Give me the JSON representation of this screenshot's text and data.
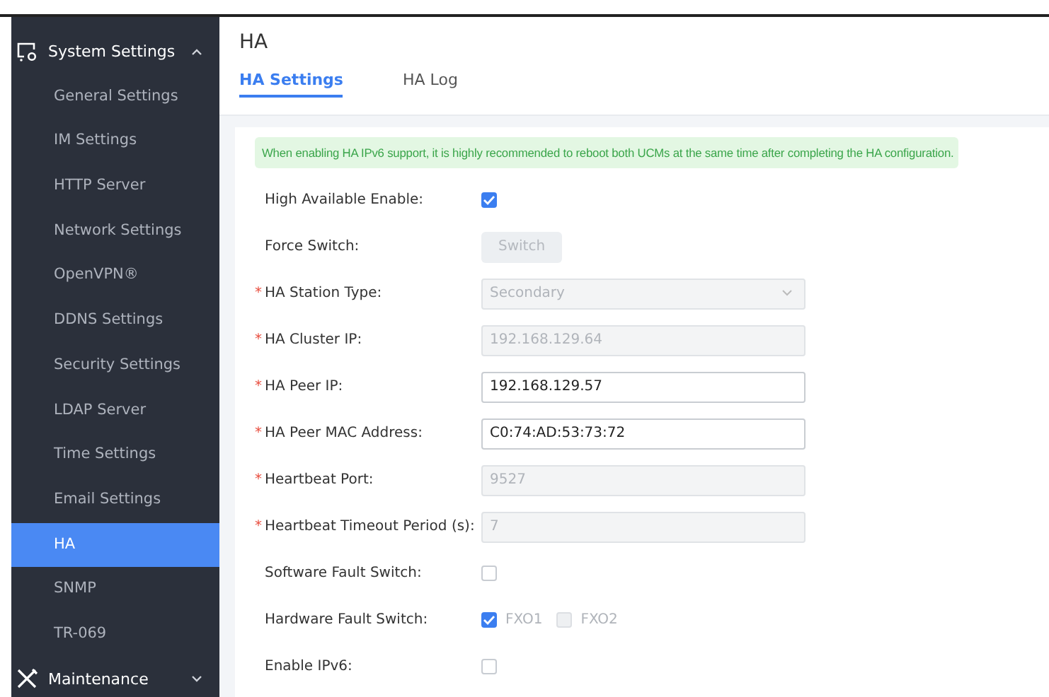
{
  "sidebar": {
    "groups": [
      {
        "label": "System Settings",
        "expanded": true,
        "items": [
          {
            "label": "General Settings",
            "selected": false
          },
          {
            "label": "IM Settings",
            "selected": false
          },
          {
            "label": "HTTP Server",
            "selected": false
          },
          {
            "label": "Network Settings",
            "selected": false
          },
          {
            "label": "OpenVPN®",
            "selected": false
          },
          {
            "label": "DDNS Settings",
            "selected": false
          },
          {
            "label": "Security Settings",
            "selected": false
          },
          {
            "label": "LDAP Server",
            "selected": false
          },
          {
            "label": "Time Settings",
            "selected": false
          },
          {
            "label": "Email Settings",
            "selected": false
          },
          {
            "label": "HA",
            "selected": true
          },
          {
            "label": "SNMP",
            "selected": false
          },
          {
            "label": "TR-069",
            "selected": false
          }
        ]
      },
      {
        "label": "Maintenance",
        "expanded": false
      }
    ]
  },
  "page": {
    "title": "HA"
  },
  "tabs": [
    {
      "label": "HA Settings",
      "selected": true
    },
    {
      "label": "HA Log",
      "selected": false
    }
  ],
  "alert": "When enabling HA IPv6 support, it is highly recommended to reboot both UCMs at the same time after completing the HA configuration.",
  "fields": [
    {
      "kind": "checkbox",
      "label": "High Available Enable:",
      "checked": true
    },
    {
      "kind": "button",
      "label": "Force Switch:",
      "button_label": "Switch",
      "disabled": true
    },
    {
      "kind": "select",
      "marker": "*",
      "label": "HA Station Type:",
      "value": "Secondary",
      "disabled": true
    },
    {
      "kind": "input",
      "marker": "*",
      "label": "HA Cluster IP:",
      "value": "192.168.129.64",
      "disabled": true
    },
    {
      "kind": "input",
      "marker": "*",
      "label": "HA Peer IP:",
      "value": "192.168.129.57",
      "disabled": false
    },
    {
      "kind": "input",
      "marker": "*",
      "label": "HA Peer MAC Address:",
      "value": "C0:74:AD:53:73:72",
      "disabled": false
    },
    {
      "kind": "input",
      "marker": "*",
      "label": "Heartbeat Port:",
      "value": "9527",
      "disabled": true
    },
    {
      "kind": "input",
      "marker": "*",
      "label": "Heartbeat Timeout Period (s):",
      "value": "7",
      "disabled": true
    },
    {
      "kind": "checkbox",
      "label": "Software Fault Switch:",
      "checked": false
    },
    {
      "kind": "checkbox_group",
      "label": "Hardware Fault Switch:",
      "options": [
        {
          "label": "FXO1",
          "checked": true,
          "disabled": true
        },
        {
          "label": "FXO2",
          "checked": false,
          "disabled": true
        }
      ]
    },
    {
      "kind": "checkbox",
      "label": "Enable IPv6:",
      "checked": false
    }
  ]
}
